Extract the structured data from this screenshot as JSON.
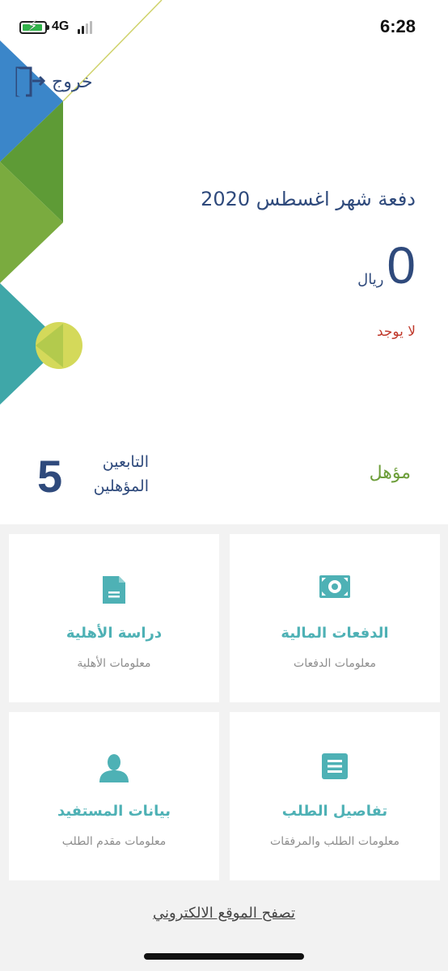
{
  "status_bar": {
    "time": "6:28",
    "network": "4G"
  },
  "header": {
    "logout_label": "خروج"
  },
  "payment": {
    "title": "دفعة شهر اغسطس 2020",
    "amount": "0",
    "currency": "ريال",
    "status": "لا يوجد"
  },
  "eligibility": {
    "status": "مؤهل",
    "dependents_label": "التابعين المؤهلين",
    "dependents_count": "5"
  },
  "cards": [
    {
      "title": "الدفعات المالية",
      "subtitle": "معلومات الدفعات",
      "icon": "money-icon"
    },
    {
      "title": "دراسة الأهلية",
      "subtitle": "معلومات الأهلية",
      "icon": "document-icon"
    },
    {
      "title": "تفاصيل الطلب",
      "subtitle": "معلومات الطلب والمرفقات",
      "icon": "list-icon"
    },
    {
      "title": "بيانات المستفيد",
      "subtitle": "معلومات مقدم الطلب",
      "icon": "user-icon"
    }
  ],
  "footer": {
    "website_link": "تصفح الموقع الالكتروني"
  },
  "colors": {
    "navy": "#2f4a7c",
    "teal": "#4eb1b5",
    "green": "#6d9e3a",
    "red": "#c0392b",
    "blue": "#3b86c9",
    "olive": "#d4d95a"
  }
}
